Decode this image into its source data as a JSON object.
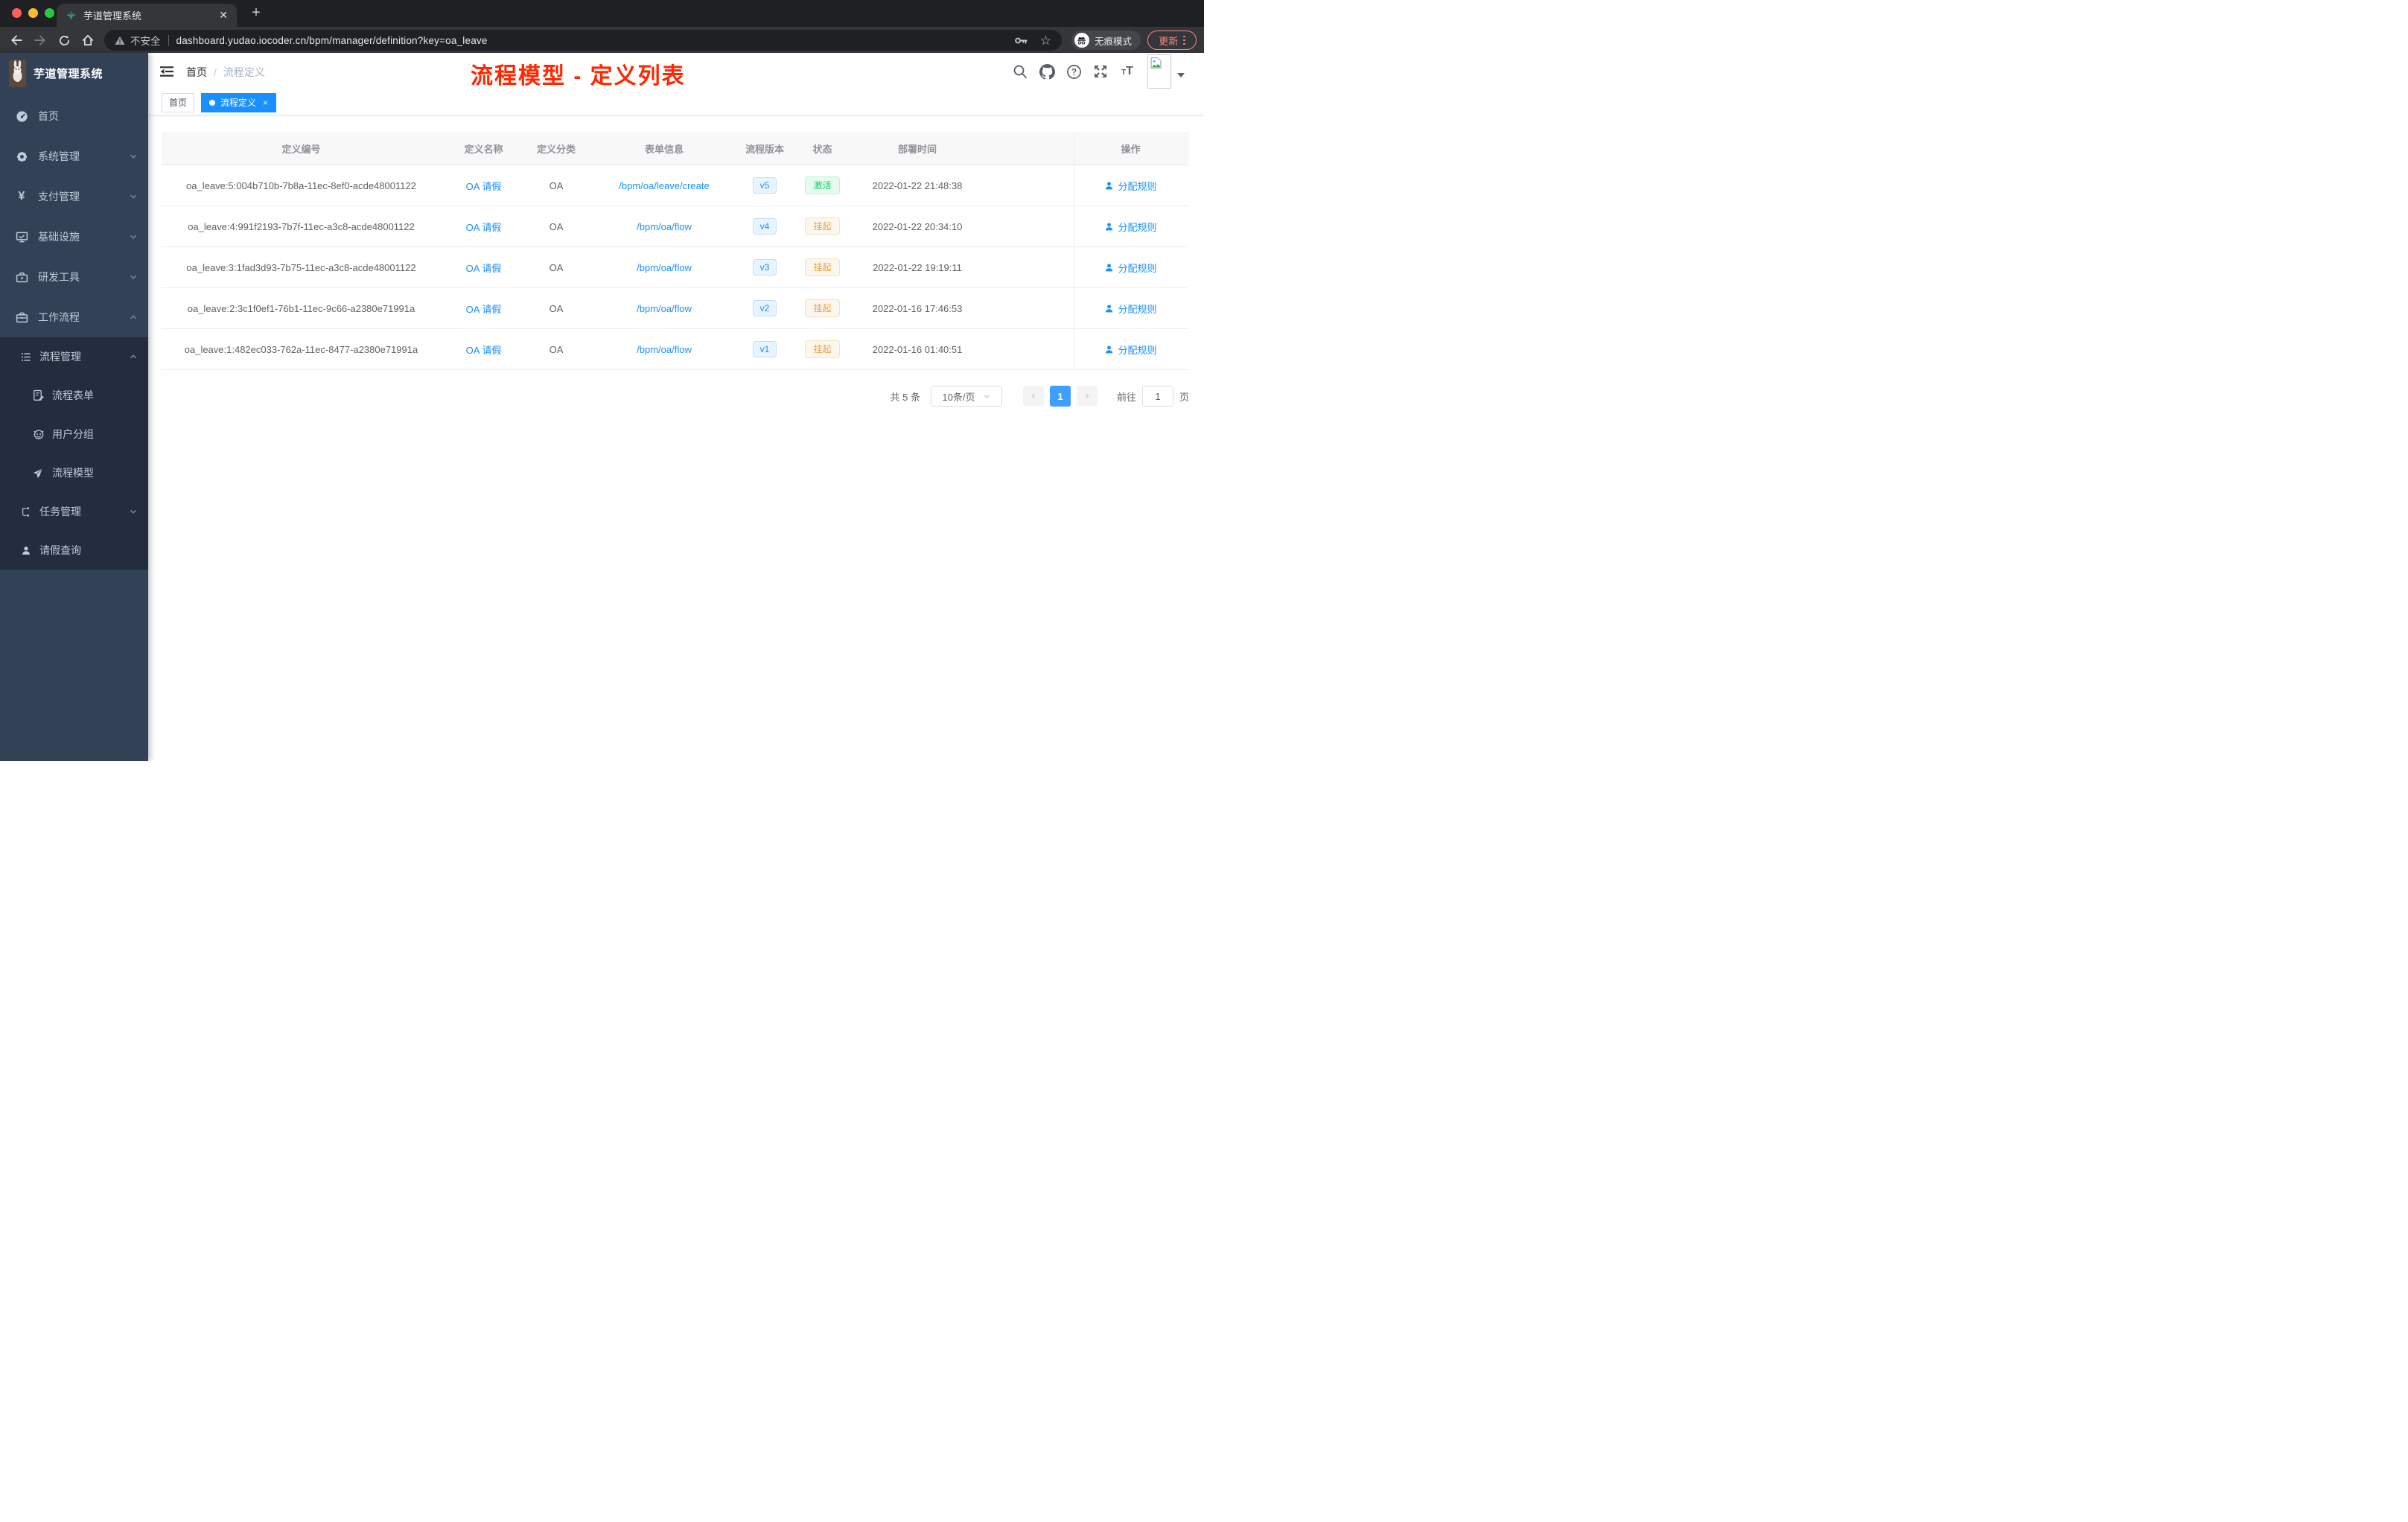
{
  "browser": {
    "tab_title": "芋道管理系统",
    "close_glyph": "✕",
    "new_tab_glyph": "+",
    "security_label": "不安全",
    "url": "dashboard.yudao.iocoder.cn/bpm/manager/definition?key=oa_leave",
    "incognito_label": "无痕模式",
    "update_label": "更新"
  },
  "sidebar": {
    "logo_title": "芋道管理系统",
    "items": [
      {
        "label": "首页",
        "icon": "dashboard-icon"
      },
      {
        "label": "系统管理",
        "icon": "gear-icon"
      },
      {
        "label": "支付管理",
        "icon": "yen-icon"
      },
      {
        "label": "基础设施",
        "icon": "monitor-icon"
      },
      {
        "label": "研发工具",
        "icon": "toolbox-icon"
      },
      {
        "label": "工作流程",
        "icon": "briefcase-icon"
      },
      {
        "label": "流程管理",
        "icon": "tree-icon"
      },
      {
        "label": "流程表单",
        "icon": "form-icon"
      },
      {
        "label": "用户分组",
        "icon": "robot-icon"
      },
      {
        "label": "流程模型",
        "icon": "paper-plane-icon"
      },
      {
        "label": "任务管理",
        "icon": "flow-icon"
      },
      {
        "label": "请假查询",
        "icon": "user-icon"
      }
    ]
  },
  "navbar": {
    "breadcrumb": {
      "home": "首页",
      "separator": "/",
      "current": "流程定义"
    },
    "annotation_title": "流程模型 - 定义列表"
  },
  "tags": {
    "home": "首页",
    "active": "流程定义",
    "close_glyph": "×"
  },
  "table": {
    "columns": {
      "id": "定义编号",
      "name": "定义名称",
      "category": "定义分类",
      "form": "表单信息",
      "version": "流程版本",
      "status": "状态",
      "deploy_time": "部署时间",
      "actions": "操作"
    },
    "action_label": "分配规则",
    "rows": [
      {
        "id": "oa_leave:5:004b710b-7b8a-11ec-8ef0-acde48001122",
        "name": "OA 请假",
        "category": "OA",
        "form": "/bpm/oa/leave/create",
        "version": "v5",
        "status": "激活",
        "deploy_time": "2022-01-22 21:48:38"
      },
      {
        "id": "oa_leave:4:991f2193-7b7f-11ec-a3c8-acde48001122",
        "name": "OA 请假",
        "category": "OA",
        "form": "/bpm/oa/flow",
        "version": "v4",
        "status": "挂起",
        "deploy_time": "2022-01-22 20:34:10"
      },
      {
        "id": "oa_leave:3:1fad3d93-7b75-11ec-a3c8-acde48001122",
        "name": "OA 请假",
        "category": "OA",
        "form": "/bpm/oa/flow",
        "version": "v3",
        "status": "挂起",
        "deploy_time": "2022-01-22 19:19:11"
      },
      {
        "id": "oa_leave:2:3c1f0ef1-76b1-11ec-9c66-a2380e71991a",
        "name": "OA 请假",
        "category": "OA",
        "form": "/bpm/oa/flow",
        "version": "v2",
        "status": "挂起",
        "deploy_time": "2022-01-16 17:46:53"
      },
      {
        "id": "oa_leave:1:482ec033-762a-11ec-8477-a2380e71991a",
        "name": "OA 请假",
        "category": "OA",
        "form": "/bpm/oa/flow",
        "version": "v1",
        "status": "挂起",
        "deploy_time": "2022-01-16 01:40:51"
      }
    ]
  },
  "pagination": {
    "total_label": "共 5 条",
    "page_size_label": "10条/页",
    "prev_glyph": "‹",
    "next_glyph": "›",
    "current_page": "1",
    "goto_label": "前往",
    "goto_value": "1",
    "unit_label": "页"
  },
  "colors": {
    "primary": "#1890ff",
    "annotation_red": "#ff2600",
    "success_green": "#13ce66",
    "warning_orange": "#e6a23c",
    "sidebar_bg": "#324156",
    "sidebar_nested_bg": "#242d3e"
  }
}
